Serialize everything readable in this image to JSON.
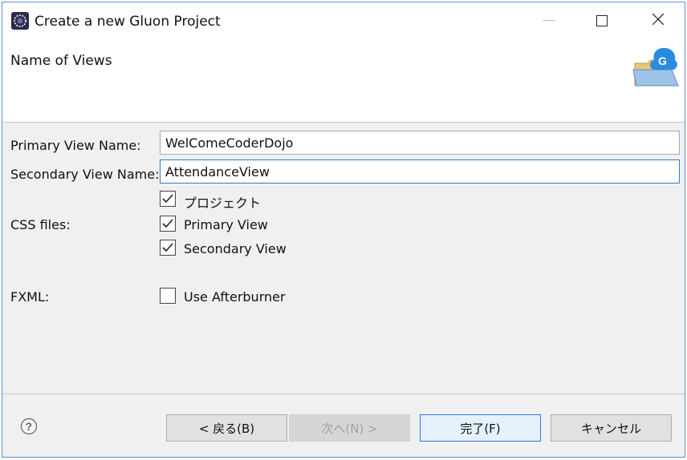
{
  "window": {
    "title": "Create a new Gluon Project"
  },
  "banner": {
    "title": "Name of Views",
    "icon": "gluon-folder-icon"
  },
  "form": {
    "primary_view_label": "Primary View Name:",
    "primary_view_value": "WelComeCoderDojo",
    "secondary_view_label": "Secondary View Name:",
    "secondary_view_value": "AttendanceView",
    "css_label": "CSS files:",
    "fxml_label": "FXML:",
    "checkboxes": [
      {
        "label": "プロジェクト",
        "checked": true
      },
      {
        "label": "Primary View",
        "checked": true
      },
      {
        "label": "Secondary View",
        "checked": true
      },
      {
        "label": "Use Afterburner",
        "checked": false
      }
    ]
  },
  "footer": {
    "back_label": "< 戻る(B)",
    "next_label": "次へ(N) >",
    "finish_label": "完了(F)",
    "cancel_label": "キャンセル"
  },
  "colors": {
    "focus_border": "#2b7bd6",
    "window_border": "#5a8ed6",
    "dialog_bg": "#f0f0f0"
  }
}
